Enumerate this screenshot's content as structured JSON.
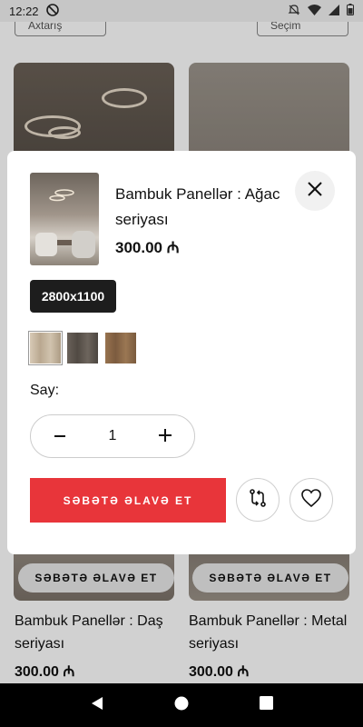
{
  "status": {
    "time": "12:22"
  },
  "background": {
    "top_left_button": "Axtarış",
    "top_right_button": "Seçim",
    "cards": [
      {
        "title": "Bambuk Panellər : Daş seriyası",
        "price": "300.00 ₼",
        "cart_label": "SƏBƏTƏ ƏLAVƏ ET"
      },
      {
        "title": "Bambuk Panellər : Metal seriyası",
        "price": "300.00 ₼",
        "cart_label": "SƏBƏTƏ ƏLAVƏ ET"
      }
    ]
  },
  "modal": {
    "title": "Bambuk Panellər : Ağac seriyası",
    "price": "300.00 ₼",
    "size": "2800x1100",
    "swatches": [
      {
        "name": "light-wood",
        "color": "#c9b9a3",
        "selected": true
      },
      {
        "name": "dark-wood",
        "color": "#5e574f",
        "selected": false
      },
      {
        "name": "medium-wood",
        "color": "#8c6a4c",
        "selected": false
      }
    ],
    "quantity_label": "Say:",
    "quantity": "1",
    "add_to_cart": "SƏBƏTƏ ƏLAVƏ ET"
  },
  "colors": {
    "accent": "#e8353a",
    "badge": "#1d1d1d"
  }
}
